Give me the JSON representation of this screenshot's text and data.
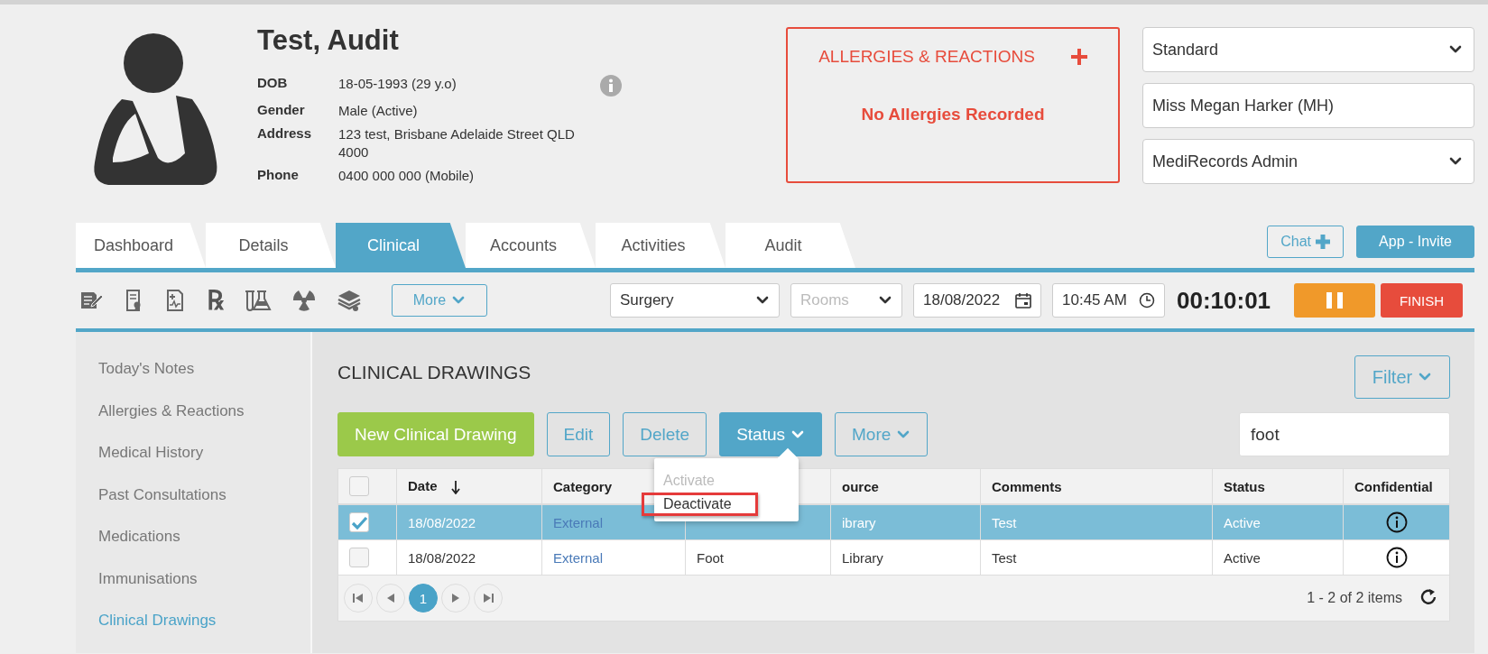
{
  "patient": {
    "name": "Test, Audit",
    "fields": [
      {
        "label": "DOB",
        "value": "18-05-1993 (29 y.o)",
        "info": true
      },
      {
        "label": "Gender",
        "value": "Male (Active)",
        "info": false
      },
      {
        "label": "Address",
        "value": "123 test, Brisbane Adelaide Street QLD 4000",
        "info": false
      },
      {
        "label": "Phone",
        "value": "0400 000 000 (Mobile)",
        "info": false
      }
    ]
  },
  "allergies": {
    "title": "ALLERGIES & REACTIONS",
    "message": "No Allergies Recorded"
  },
  "selectors": [
    {
      "kind": "select",
      "value": "Standard"
    },
    {
      "kind": "text",
      "value": "Miss Megan Harker (MH)"
    },
    {
      "kind": "select",
      "value": "MediRecords Admin"
    }
  ],
  "tabs": [
    {
      "label": "Dashboard",
      "selected": false
    },
    {
      "label": "Details",
      "selected": false
    },
    {
      "label": "Clinical",
      "selected": true
    },
    {
      "label": "Accounts",
      "selected": false
    },
    {
      "label": "Activities",
      "selected": false
    },
    {
      "label": "Audit",
      "selected": false
    }
  ],
  "header_buttons": [
    {
      "label": "Chat",
      "kind": "outline"
    },
    {
      "label": "App - Invite",
      "kind": "filled"
    }
  ],
  "toolbar": {
    "rx_symbol": "℞",
    "more": "More",
    "location": "Surgery",
    "rooms_placeholder": "Rooms",
    "date": "18/08/2022",
    "time": "10:45 AM",
    "timer": "00:10:01",
    "finish": "FINISH"
  },
  "sidebar": {
    "items": [
      {
        "label": "Today's Notes",
        "selected": false
      },
      {
        "label": "Allergies & Reactions",
        "selected": false
      },
      {
        "label": "Medical History",
        "selected": false
      },
      {
        "label": "Past Consultations",
        "selected": false
      },
      {
        "label": "Medications",
        "selected": false
      },
      {
        "label": "Immunisations",
        "selected": false
      },
      {
        "label": "Clinical Drawings",
        "selected": true
      }
    ]
  },
  "section": {
    "title": "CLINICAL DRAWINGS",
    "filter": "Filter",
    "search_value": "foot",
    "actions": [
      {
        "label": "New Clinical Drawing",
        "kind": "primary"
      },
      {
        "label": "Edit",
        "kind": "outline"
      },
      {
        "label": "Delete",
        "kind": "outline"
      },
      {
        "label": "Status",
        "kind": "dropdown-filled"
      },
      {
        "label": "More",
        "kind": "dropdown-outline"
      }
    ]
  },
  "status_menu": {
    "items": [
      {
        "label": "Activate",
        "disabled": true,
        "highlighted": false
      },
      {
        "label": "Deactivate",
        "disabled": false,
        "highlighted": true
      }
    ]
  },
  "table": {
    "header_checked": false,
    "columns": [
      {
        "label": "Date",
        "sorted": true
      },
      {
        "label": "Category",
        "sorted": false
      },
      {},
      {
        "label": "ource",
        "sorted": false
      },
      {
        "label": "Comments",
        "sorted": false
      },
      {
        "label": "Status",
        "sorted": false
      },
      {
        "label": "Confidential",
        "sorted": false
      }
    ],
    "rows": [
      {
        "checked": true,
        "selected": true,
        "date": "18/08/2022",
        "category": "External",
        "source": "ibrary",
        "comments": "Test",
        "status": "Active"
      },
      {
        "checked": false,
        "selected": false,
        "date": "18/08/2022",
        "category": "External",
        "column_4": "Foot",
        "source": "Library",
        "comments": "Test",
        "status": "Active"
      }
    ],
    "pages": [
      {
        "label": "1",
        "selected": true
      }
    ],
    "summary": "1 - 2 of 2 items"
  }
}
